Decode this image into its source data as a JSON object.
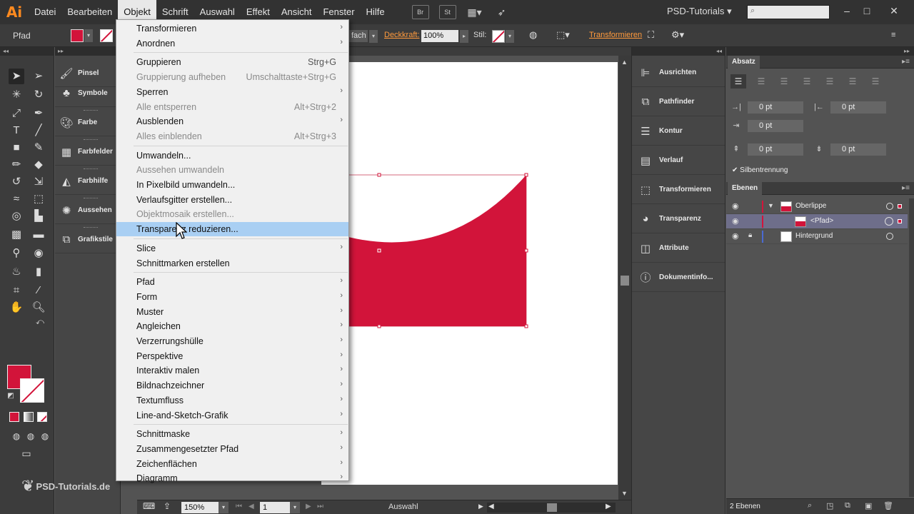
{
  "app": {
    "logo": "Ai",
    "workspace": "PSD-Tutorials",
    "workspace_arrow": "▾"
  },
  "menubar": {
    "items": [
      "Datei",
      "Bearbeiten",
      "Objekt",
      "Schrift",
      "Auswahl",
      "Effekt",
      "Ansicht",
      "Fenster",
      "Hilfe"
    ],
    "active": "Objekt",
    "buttons": [
      "Br",
      "St"
    ]
  },
  "controlbar": {
    "selection_label": "Pfad",
    "mode_text": "fach",
    "opacity_label": "Deckkraft:",
    "opacity_value": "100%",
    "style_label": "Stil:",
    "transform_link": "Transformieren"
  },
  "object_menu": [
    {
      "label": "Transformieren",
      "shortcut": "",
      "submenu": true,
      "disabled": false
    },
    {
      "label": "Anordnen",
      "shortcut": "",
      "submenu": true,
      "disabled": false
    },
    {
      "sep": true
    },
    {
      "label": "Gruppieren",
      "shortcut": "Strg+G",
      "submenu": false,
      "disabled": false
    },
    {
      "label": "Gruppierung aufheben",
      "shortcut": "Umschalttaste+Strg+G",
      "submenu": false,
      "disabled": true
    },
    {
      "label": "Sperren",
      "shortcut": "",
      "submenu": true,
      "disabled": false
    },
    {
      "label": "Alle entsperren",
      "shortcut": "Alt+Strg+2",
      "submenu": false,
      "disabled": true
    },
    {
      "label": "Ausblenden",
      "shortcut": "",
      "submenu": true,
      "disabled": false
    },
    {
      "label": "Alles einblenden",
      "shortcut": "Alt+Strg+3",
      "submenu": false,
      "disabled": true
    },
    {
      "sep": true
    },
    {
      "label": "Umwandeln...",
      "shortcut": "",
      "submenu": false,
      "disabled": false
    },
    {
      "label": "Aussehen umwandeln",
      "shortcut": "",
      "submenu": false,
      "disabled": true
    },
    {
      "label": "In Pixelbild umwandeln...",
      "shortcut": "",
      "submenu": false,
      "disabled": false
    },
    {
      "label": "Verlaufsgitter erstellen...",
      "shortcut": "",
      "submenu": false,
      "disabled": false
    },
    {
      "label": "Objektmosaik erstellen...",
      "shortcut": "",
      "submenu": false,
      "disabled": true
    },
    {
      "label": "Transparenz reduzieren...",
      "shortcut": "",
      "submenu": false,
      "disabled": false,
      "highlighted": true
    },
    {
      "sep": true
    },
    {
      "label": "Slice",
      "shortcut": "",
      "submenu": true,
      "disabled": false
    },
    {
      "label": "Schnittmarken erstellen",
      "shortcut": "",
      "submenu": false,
      "disabled": false
    },
    {
      "sep": true
    },
    {
      "label": "Pfad",
      "shortcut": "",
      "submenu": true,
      "disabled": false
    },
    {
      "label": "Form",
      "shortcut": "",
      "submenu": true,
      "disabled": false
    },
    {
      "label": "Muster",
      "shortcut": "",
      "submenu": true,
      "disabled": false
    },
    {
      "label": "Angleichen",
      "shortcut": "",
      "submenu": true,
      "disabled": false
    },
    {
      "label": "Verzerrungshülle",
      "shortcut": "",
      "submenu": true,
      "disabled": false
    },
    {
      "label": "Perspektive",
      "shortcut": "",
      "submenu": true,
      "disabled": false
    },
    {
      "label": "Interaktiv malen",
      "shortcut": "",
      "submenu": true,
      "disabled": false
    },
    {
      "label": "Bildnachzeichner",
      "shortcut": "",
      "submenu": true,
      "disabled": false
    },
    {
      "label": "Textumfluss",
      "shortcut": "",
      "submenu": true,
      "disabled": false
    },
    {
      "label": "Line-and-Sketch-Grafik",
      "shortcut": "",
      "submenu": true,
      "disabled": false
    },
    {
      "sep": true
    },
    {
      "label": "Schnittmaske",
      "shortcut": "",
      "submenu": true,
      "disabled": false
    },
    {
      "label": "Zusammengesetzter Pfad",
      "shortcut": "",
      "submenu": true,
      "disabled": false
    },
    {
      "label": "Zeichenflächen",
      "shortcut": "",
      "submenu": true,
      "disabled": false
    },
    {
      "label": "Diagramm",
      "shortcut": "",
      "submenu": true,
      "disabled": false
    }
  ],
  "left_panels": [
    {
      "label": "Pinsel",
      "icon": "brush-icon"
    },
    {
      "label": "Symbole",
      "icon": "club-icon"
    },
    {
      "label": "Farbe",
      "icon": "palette-icon"
    },
    {
      "label": "Farbfelder",
      "icon": "grid-icon"
    },
    {
      "label": "Farbhilfe",
      "icon": "guide-icon"
    },
    {
      "label": "Aussehen",
      "icon": "sun-icon"
    },
    {
      "label": "Grafikstile",
      "icon": "styles-icon"
    }
  ],
  "mid_panels": [
    {
      "label": "Ausrichten",
      "icon": "align-icon"
    },
    {
      "label": "Pathfinder",
      "icon": "pathfinder-icon"
    },
    {
      "label": "Kontur",
      "icon": "stroke-icon"
    },
    {
      "label": "Verlauf",
      "icon": "gradient-icon"
    },
    {
      "label": "Transformieren",
      "icon": "transform-icon"
    },
    {
      "label": "Transparenz",
      "icon": "transparency-icon"
    },
    {
      "label": "Attribute",
      "icon": "attributes-icon"
    },
    {
      "label": "Dokumentinfo...",
      "icon": "info-icon"
    }
  ],
  "paragraph_panel": {
    "title": "Absatz",
    "indent_left": "0 pt",
    "indent_right": "0 pt",
    "indent_first": "0 pt",
    "space_before": "0 pt",
    "space_after": "0 pt",
    "hyphenation_label": "Silbentrennung",
    "hyphenation_checked": true
  },
  "layers_panel": {
    "title": "Ebenen",
    "layers": [
      {
        "name": "Oberlippe",
        "level": 0,
        "expanded": true,
        "selected": false,
        "color": "#d2143a"
      },
      {
        "name": "<Pfad>",
        "level": 1,
        "selected": true,
        "color": "#d2143a"
      },
      {
        "name": "Hintergrund",
        "level": 0,
        "selected": false,
        "locked": true,
        "color": "#4a6ad2"
      }
    ],
    "count": "2 Ebenen"
  },
  "statusbar": {
    "zoom": "150%",
    "page": "1",
    "tool": "Auswahl"
  },
  "watermark": "PSD-Tutorials.de",
  "colors": {
    "fill": "#d2143a",
    "accent": "#ff9a3c",
    "highlight": "#a9cff3"
  }
}
